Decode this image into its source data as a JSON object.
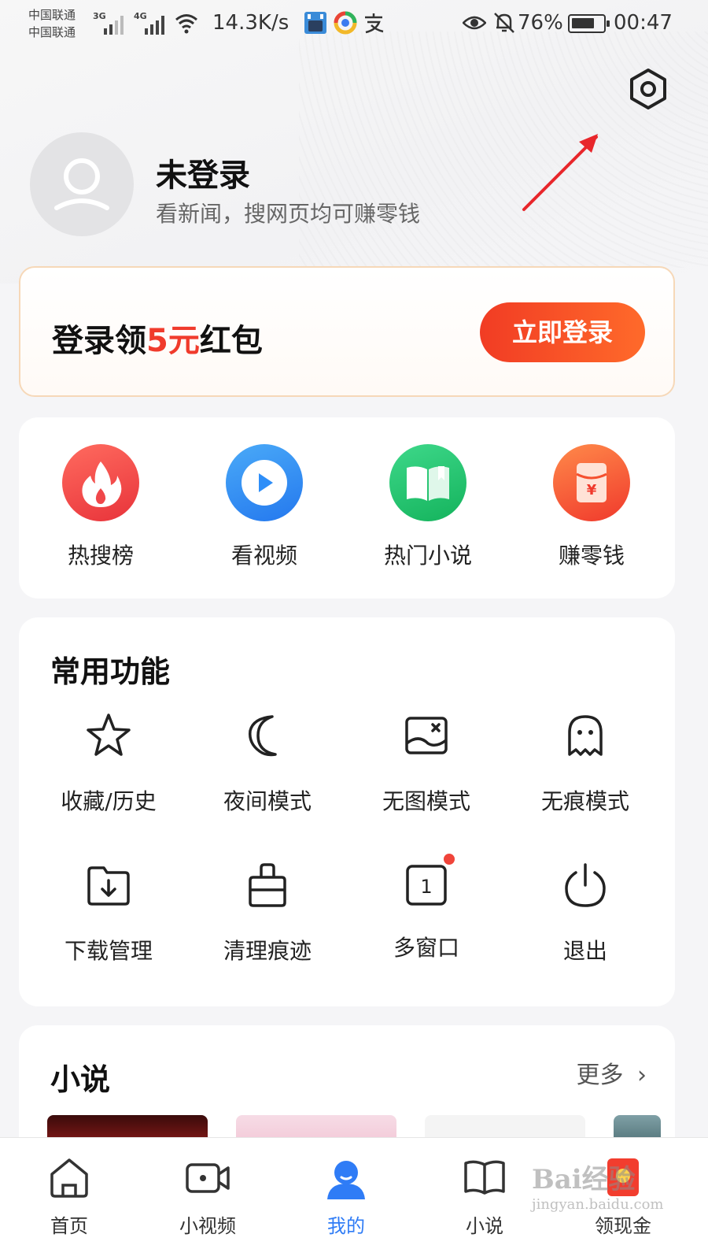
{
  "status_bar": {
    "carrier1": "中国联通",
    "carrier2": "中国联通",
    "net1": "3G",
    "net2": "4G",
    "speed": "14.3K/s",
    "battery_pct": "76%",
    "battery_level": 0.76,
    "time": "00:47",
    "icons": [
      "wifi-icon",
      "app-icon",
      "browser-icon",
      "alipay-icon",
      "eye-icon",
      "mute-icon",
      "battery-icon"
    ]
  },
  "header": {
    "settings_icon": "settings-icon",
    "username": "未登录",
    "subtitle": "看新闻，搜网页均可赚零钱"
  },
  "promo": {
    "prefix": "登录领",
    "amount": "5元",
    "suffix": "红包",
    "button": "立即登录"
  },
  "quick_actions": [
    {
      "label": "热搜榜",
      "icon": "fire-icon",
      "color": "#f04b45"
    },
    {
      "label": "看视频",
      "icon": "play-icon",
      "color": "#2e8ef8"
    },
    {
      "label": "热门小说",
      "icon": "book-icon",
      "color": "#21c66f"
    },
    {
      "label": "赚零钱",
      "icon": "red-envelope-icon",
      "color": "#f5502f"
    }
  ],
  "common_functions": {
    "title": "常用功能",
    "items": [
      {
        "label": "收藏/历史",
        "icon": "star-icon"
      },
      {
        "label": "夜间模式",
        "icon": "moon-icon"
      },
      {
        "label": "无图模式",
        "icon": "no-image-icon"
      },
      {
        "label": "无痕模式",
        "icon": "ghost-icon"
      },
      {
        "label": "下载管理",
        "icon": "download-folder-icon"
      },
      {
        "label": "清理痕迹",
        "icon": "clean-icon"
      },
      {
        "label": "多窗口",
        "icon": "window-count-icon",
        "badge_number": "1"
      },
      {
        "label": "退出",
        "icon": "power-icon"
      }
    ]
  },
  "novel_section": {
    "title": "小说",
    "more": "更多"
  },
  "tabbar": [
    {
      "label": "首页",
      "icon": "home-icon"
    },
    {
      "label": "小视频",
      "icon": "video-icon"
    },
    {
      "label": "我的",
      "icon": "profile-icon",
      "active": true
    },
    {
      "label": "小说",
      "icon": "novel-icon"
    },
    {
      "label": "领现金",
      "icon": "cash-icon"
    }
  ],
  "watermark": {
    "brand": "Bai经验",
    "url": "jingyan.baidu.com"
  },
  "colors": {
    "accent_red": "#f03b2c",
    "active_blue": "#2f7cf6",
    "background": "#f5f5f7"
  }
}
